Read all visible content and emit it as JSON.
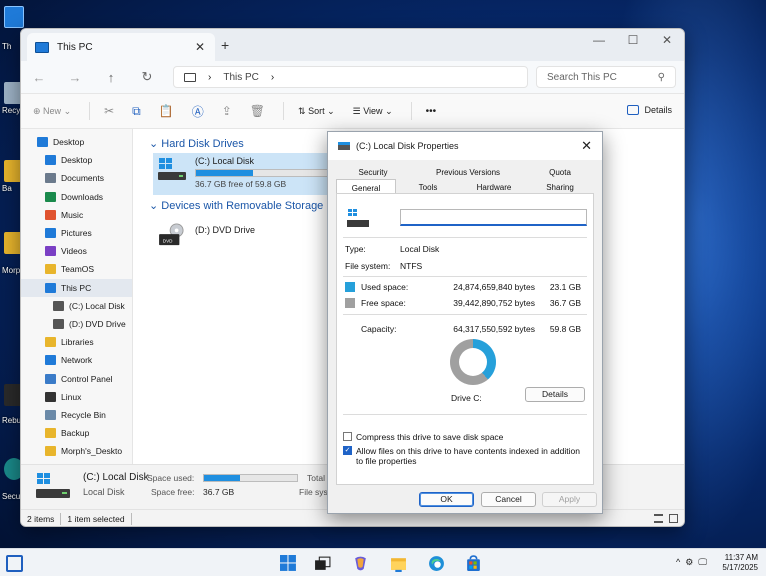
{
  "desktop": {
    "icons": [
      {
        "label": "Th"
      },
      {
        "label": "Recy"
      },
      {
        "label": "Ba"
      },
      {
        "label": "Morp"
      },
      {
        "label": "Rebu"
      },
      {
        "label": "Secu"
      }
    ]
  },
  "explorer": {
    "tab_title": "This PC",
    "new_tab": "+",
    "address_path": "This PC",
    "search_placeholder": "Search This PC",
    "toolbar": {
      "new_label": "New",
      "sort_label": "Sort",
      "view_label": "View",
      "more_label": "•••",
      "details_label": "Details"
    },
    "sidebar": [
      {
        "label": "Desktop",
        "level": "l1",
        "color": "#1f7ad8"
      },
      {
        "label": "Desktop",
        "level": "l2",
        "color": "#1f7ad8"
      },
      {
        "label": "Documents",
        "level": "l2",
        "color": "#6b7a8c"
      },
      {
        "label": "Downloads",
        "level": "l2",
        "color": "#1a8a4c"
      },
      {
        "label": "Music",
        "level": "l2",
        "color": "#e0532f"
      },
      {
        "label": "Pictures",
        "level": "l2",
        "color": "#1f7ad8"
      },
      {
        "label": "Videos",
        "level": "l2",
        "color": "#7a3fc4"
      },
      {
        "label": "TeamOS",
        "level": "l2",
        "color": "#e8b52c"
      },
      {
        "label": "This PC",
        "level": "l2",
        "color": "#1f7ad8"
      },
      {
        "label": "(C:) Local Disk",
        "level": "l3",
        "color": "#555555"
      },
      {
        "label": "(D:) DVD Drive",
        "level": "l3",
        "color": "#555555"
      },
      {
        "label": "Libraries",
        "level": "l2",
        "color": "#e8b52c"
      },
      {
        "label": "Network",
        "level": "l2",
        "color": "#1f7ad8"
      },
      {
        "label": "Control Panel",
        "level": "l2",
        "color": "#3a7bc8"
      },
      {
        "label": "Linux",
        "level": "l2",
        "color": "#333333"
      },
      {
        "label": "Recycle Bin",
        "level": "l2",
        "color": "#6b8aa8"
      },
      {
        "label": "Backup",
        "level": "l2",
        "color": "#e8b52c"
      },
      {
        "label": "Morph's_Deskto",
        "level": "l2",
        "color": "#e8b52c"
      }
    ],
    "groups": {
      "hdd": "Hard Disk Drives",
      "removable": "Devices with Removable Storage"
    },
    "drive_c": {
      "name": "(C:) Local Disk",
      "free_text": "36.7 GB free of 59.8 GB",
      "used_fraction": 0.387
    },
    "drive_d": {
      "name": "(D:) DVD Drive",
      "badge": "DVD"
    },
    "infobar": {
      "name": "(C:) Local Disk",
      "type": "Local Disk",
      "space_used_label": "Space used:",
      "space_free_label": "Space free:",
      "space_free_value": "36.7 GB",
      "total_label": "Total",
      "filesys_label": "File syst"
    },
    "status": {
      "items": "2 items",
      "selected": "1 item selected"
    }
  },
  "properties": {
    "title": "(C:) Local Disk Properties",
    "tabs_row1": [
      "Security",
      "Previous Versions",
      "Quota"
    ],
    "tabs_row2": [
      "General",
      "Tools",
      "Hardware",
      "Sharing"
    ],
    "name_value": "",
    "type_label": "Type:",
    "type_value": "Local Disk",
    "fs_label": "File system:",
    "fs_value": "NTFS",
    "used_label": "Used space:",
    "used_bytes": "24,874,659,840 bytes",
    "used_gb": "23.1 GB",
    "free_label": "Free space:",
    "free_bytes": "39,442,890,752 bytes",
    "free_gb": "36.7 GB",
    "capacity_label": "Capacity:",
    "capacity_bytes": "64,317,550,592 bytes",
    "capacity_gb": "59.8 GB",
    "used_color": "#26a0da",
    "free_color": "#a0a0a0",
    "drive_label": "Drive C:",
    "details_button": "Details",
    "compress_label": "Compress this drive to save disk space",
    "index_label": "Allow files on this drive to have contents indexed in addition to file properties",
    "ok": "OK",
    "cancel": "Cancel",
    "apply": "Apply"
  },
  "taskbar": {
    "time": "11:37 AM",
    "date": "5/17/2025"
  }
}
